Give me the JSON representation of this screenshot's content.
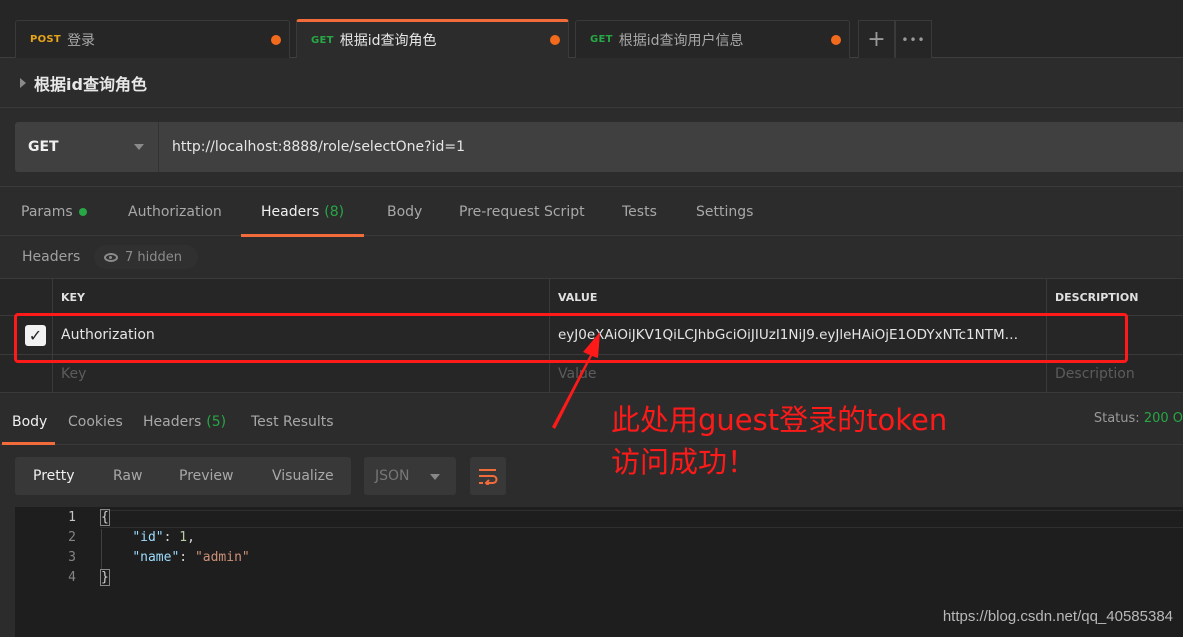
{
  "tabs": [
    {
      "method": "POST",
      "name": "登录",
      "active": false,
      "unsaved": true
    },
    {
      "method": "GET",
      "name": "根据id查询角色",
      "active": true,
      "unsaved": true
    },
    {
      "method": "GET",
      "name": "根据id查询用户信息",
      "active": false,
      "unsaved": true
    }
  ],
  "tab_actions": {
    "new_tab": "+",
    "more": "•••"
  },
  "request": {
    "title": "根据id查询角色",
    "method": "GET",
    "url": "http://localhost:8888/role/selectOne?id=1"
  },
  "request_tabs": [
    {
      "label": "Params",
      "indicator": "green-dot"
    },
    {
      "label": "Authorization"
    },
    {
      "label": "Headers",
      "count": "(8)",
      "active": true
    },
    {
      "label": "Body"
    },
    {
      "label": "Pre-request Script"
    },
    {
      "label": "Tests"
    },
    {
      "label": "Settings"
    }
  ],
  "headers_section": {
    "label": "Headers",
    "hidden_label": "7 hidden",
    "columns": {
      "key": "KEY",
      "value": "VALUE",
      "description": "DESCRIPTION"
    },
    "rows": [
      {
        "checked": true,
        "key": "Authorization",
        "value": "eyJ0eXAiOiJKV1QiLCJhbGciOiJIUzI1NiJ9.eyJleHAiOjE1ODYxNTc1NTM…",
        "description": ""
      }
    ],
    "placeholders": {
      "key": "Key",
      "value": "Value",
      "description": "Description"
    }
  },
  "response": {
    "tabs": [
      {
        "label": "Body",
        "active": true
      },
      {
        "label": "Cookies"
      },
      {
        "label": "Headers",
        "count": "(5)"
      },
      {
        "label": "Test Results"
      }
    ],
    "status_label": "Status:",
    "status_value": "200 O",
    "view_modes": [
      "Pretty",
      "Raw",
      "Preview",
      "Visualize"
    ],
    "active_view": "Pretty",
    "language": "JSON",
    "code_lines": [
      {
        "num": "1",
        "text": "{"
      },
      {
        "num": "2",
        "key": "\"id\"",
        "sep": ": ",
        "num_val": "1",
        "tail": ","
      },
      {
        "num": "3",
        "key": "\"name\"",
        "sep": ": ",
        "str_val": "\"admin\""
      },
      {
        "num": "4",
        "text": "}"
      }
    ]
  },
  "annotation": {
    "line1": "此处用guest登录的token",
    "line2": "访问成功！",
    "color": "#ff1a1a"
  },
  "watermark": "https://blog.csdn.net/qq_40585384",
  "colors": {
    "accent": "#f26b3a",
    "get": "#27a745",
    "post": "#e6a41b",
    "unsaved_dot": "#f26b1d"
  }
}
